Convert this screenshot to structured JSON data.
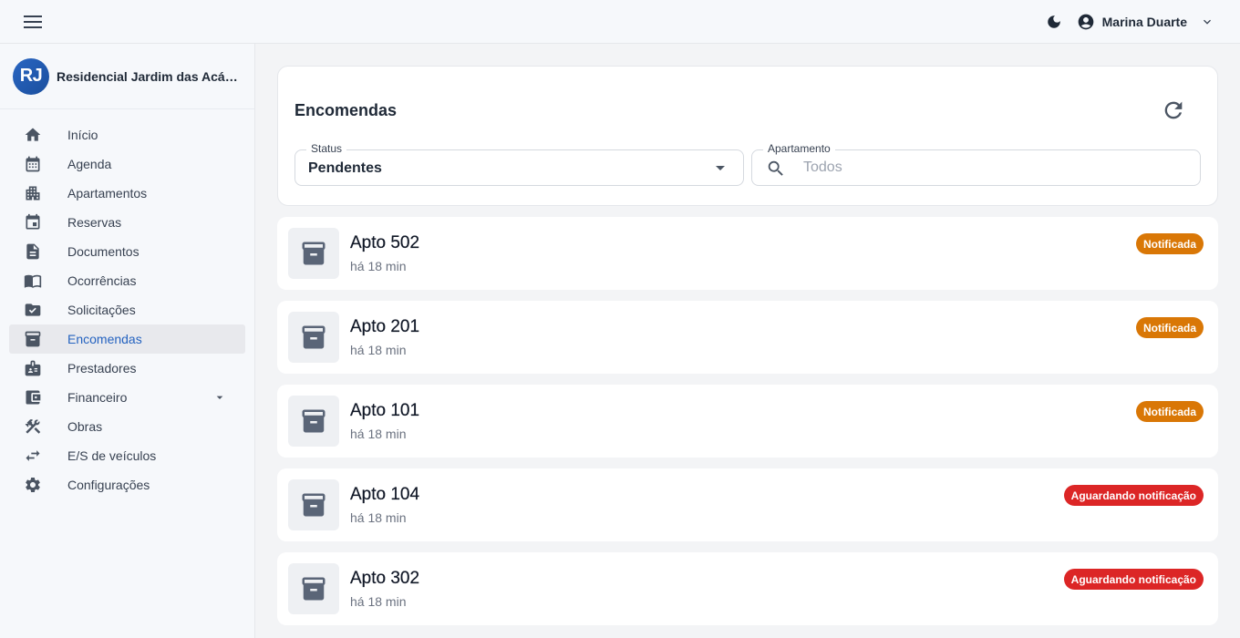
{
  "topbar": {
    "user_name": "Marina Duarte"
  },
  "sidebar": {
    "avatar_initials": "RJ",
    "title": "Residencial Jardim das Acácias",
    "items": [
      {
        "label": "Início",
        "icon": "home-icon"
      },
      {
        "label": "Agenda",
        "icon": "calendar-icon"
      },
      {
        "label": "Apartamentos",
        "icon": "apartment-icon"
      },
      {
        "label": "Reservas",
        "icon": "event-icon"
      },
      {
        "label": "Documentos",
        "icon": "document-icon"
      },
      {
        "label": "Ocorrências",
        "icon": "book-icon"
      },
      {
        "label": "Solicitações",
        "icon": "folder-icon"
      },
      {
        "label": "Encomendas",
        "icon": "archive-icon"
      },
      {
        "label": "Prestadores",
        "icon": "badge-icon"
      },
      {
        "label": "Financeiro",
        "icon": "wallet-icon"
      },
      {
        "label": "Obras",
        "icon": "tools-icon"
      },
      {
        "label": "E/S de veículos",
        "icon": "swap-icon"
      },
      {
        "label": "Configurações",
        "icon": "gear-icon"
      }
    ]
  },
  "main": {
    "title": "Encomendas",
    "status_label": "Status",
    "status_value": "Pendentes",
    "apto_label": "Apartamento",
    "apto_placeholder": "Todos"
  },
  "packages": [
    {
      "apto": "Apto 502",
      "time": "há 18 min",
      "status": "Notificada",
      "color": "#d97706"
    },
    {
      "apto": "Apto 201",
      "time": "há 18 min",
      "status": "Notificada",
      "color": "#d97706"
    },
    {
      "apto": "Apto 101",
      "time": "há 18 min",
      "status": "Notificada",
      "color": "#d97706"
    },
    {
      "apto": "Apto 104",
      "time": "há 18 min",
      "status": "Aguardando notificação",
      "color": "#dc2626"
    },
    {
      "apto": "Apto 302",
      "time": "há 18 min",
      "status": "Aguardando notificação",
      "color": "#dc2626"
    }
  ]
}
